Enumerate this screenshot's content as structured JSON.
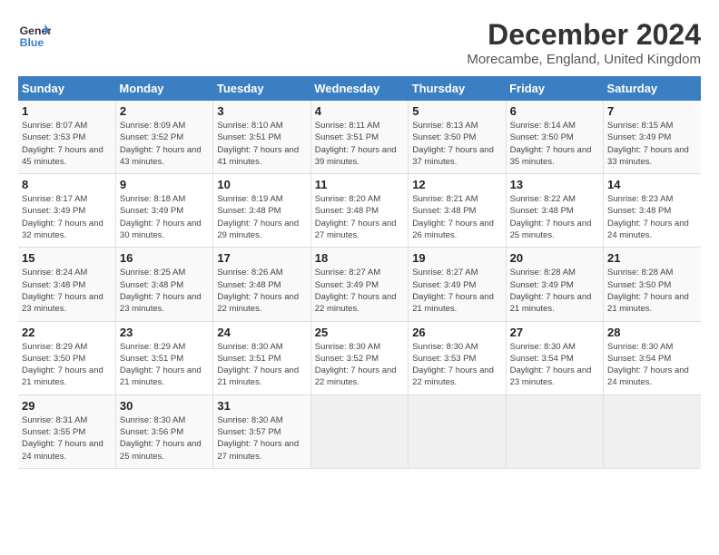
{
  "header": {
    "logo_line1": "General",
    "logo_line2": "Blue",
    "month": "December 2024",
    "location": "Morecambe, England, United Kingdom"
  },
  "days_of_week": [
    "Sunday",
    "Monday",
    "Tuesday",
    "Wednesday",
    "Thursday",
    "Friday",
    "Saturday"
  ],
  "weeks": [
    [
      {
        "num": "1",
        "sunrise": "8:07 AM",
        "sunset": "3:53 PM",
        "daylight": "7 hours and 45 minutes."
      },
      {
        "num": "2",
        "sunrise": "8:09 AM",
        "sunset": "3:52 PM",
        "daylight": "7 hours and 43 minutes."
      },
      {
        "num": "3",
        "sunrise": "8:10 AM",
        "sunset": "3:51 PM",
        "daylight": "7 hours and 41 minutes."
      },
      {
        "num": "4",
        "sunrise": "8:11 AM",
        "sunset": "3:51 PM",
        "daylight": "7 hours and 39 minutes."
      },
      {
        "num": "5",
        "sunrise": "8:13 AM",
        "sunset": "3:50 PM",
        "daylight": "7 hours and 37 minutes."
      },
      {
        "num": "6",
        "sunrise": "8:14 AM",
        "sunset": "3:50 PM",
        "daylight": "7 hours and 35 minutes."
      },
      {
        "num": "7",
        "sunrise": "8:15 AM",
        "sunset": "3:49 PM",
        "daylight": "7 hours and 33 minutes."
      }
    ],
    [
      {
        "num": "8",
        "sunrise": "8:17 AM",
        "sunset": "3:49 PM",
        "daylight": "7 hours and 32 minutes."
      },
      {
        "num": "9",
        "sunrise": "8:18 AM",
        "sunset": "3:49 PM",
        "daylight": "7 hours and 30 minutes."
      },
      {
        "num": "10",
        "sunrise": "8:19 AM",
        "sunset": "3:48 PM",
        "daylight": "7 hours and 29 minutes."
      },
      {
        "num": "11",
        "sunrise": "8:20 AM",
        "sunset": "3:48 PM",
        "daylight": "7 hours and 27 minutes."
      },
      {
        "num": "12",
        "sunrise": "8:21 AM",
        "sunset": "3:48 PM",
        "daylight": "7 hours and 26 minutes."
      },
      {
        "num": "13",
        "sunrise": "8:22 AM",
        "sunset": "3:48 PM",
        "daylight": "7 hours and 25 minutes."
      },
      {
        "num": "14",
        "sunrise": "8:23 AM",
        "sunset": "3:48 PM",
        "daylight": "7 hours and 24 minutes."
      }
    ],
    [
      {
        "num": "15",
        "sunrise": "8:24 AM",
        "sunset": "3:48 PM",
        "daylight": "7 hours and 23 minutes."
      },
      {
        "num": "16",
        "sunrise": "8:25 AM",
        "sunset": "3:48 PM",
        "daylight": "7 hours and 23 minutes."
      },
      {
        "num": "17",
        "sunrise": "8:26 AM",
        "sunset": "3:48 PM",
        "daylight": "7 hours and 22 minutes."
      },
      {
        "num": "18",
        "sunrise": "8:27 AM",
        "sunset": "3:49 PM",
        "daylight": "7 hours and 22 minutes."
      },
      {
        "num": "19",
        "sunrise": "8:27 AM",
        "sunset": "3:49 PM",
        "daylight": "7 hours and 21 minutes."
      },
      {
        "num": "20",
        "sunrise": "8:28 AM",
        "sunset": "3:49 PM",
        "daylight": "7 hours and 21 minutes."
      },
      {
        "num": "21",
        "sunrise": "8:28 AM",
        "sunset": "3:50 PM",
        "daylight": "7 hours and 21 minutes."
      }
    ],
    [
      {
        "num": "22",
        "sunrise": "8:29 AM",
        "sunset": "3:50 PM",
        "daylight": "7 hours and 21 minutes."
      },
      {
        "num": "23",
        "sunrise": "8:29 AM",
        "sunset": "3:51 PM",
        "daylight": "7 hours and 21 minutes."
      },
      {
        "num": "24",
        "sunrise": "8:30 AM",
        "sunset": "3:51 PM",
        "daylight": "7 hours and 21 minutes."
      },
      {
        "num": "25",
        "sunrise": "8:30 AM",
        "sunset": "3:52 PM",
        "daylight": "7 hours and 22 minutes."
      },
      {
        "num": "26",
        "sunrise": "8:30 AM",
        "sunset": "3:53 PM",
        "daylight": "7 hours and 22 minutes."
      },
      {
        "num": "27",
        "sunrise": "8:30 AM",
        "sunset": "3:54 PM",
        "daylight": "7 hours and 23 minutes."
      },
      {
        "num": "28",
        "sunrise": "8:30 AM",
        "sunset": "3:54 PM",
        "daylight": "7 hours and 24 minutes."
      }
    ],
    [
      {
        "num": "29",
        "sunrise": "8:31 AM",
        "sunset": "3:55 PM",
        "daylight": "7 hours and 24 minutes."
      },
      {
        "num": "30",
        "sunrise": "8:30 AM",
        "sunset": "3:56 PM",
        "daylight": "7 hours and 25 minutes."
      },
      {
        "num": "31",
        "sunrise": "8:30 AM",
        "sunset": "3:57 PM",
        "daylight": "7 hours and 27 minutes."
      },
      null,
      null,
      null,
      null
    ]
  ]
}
